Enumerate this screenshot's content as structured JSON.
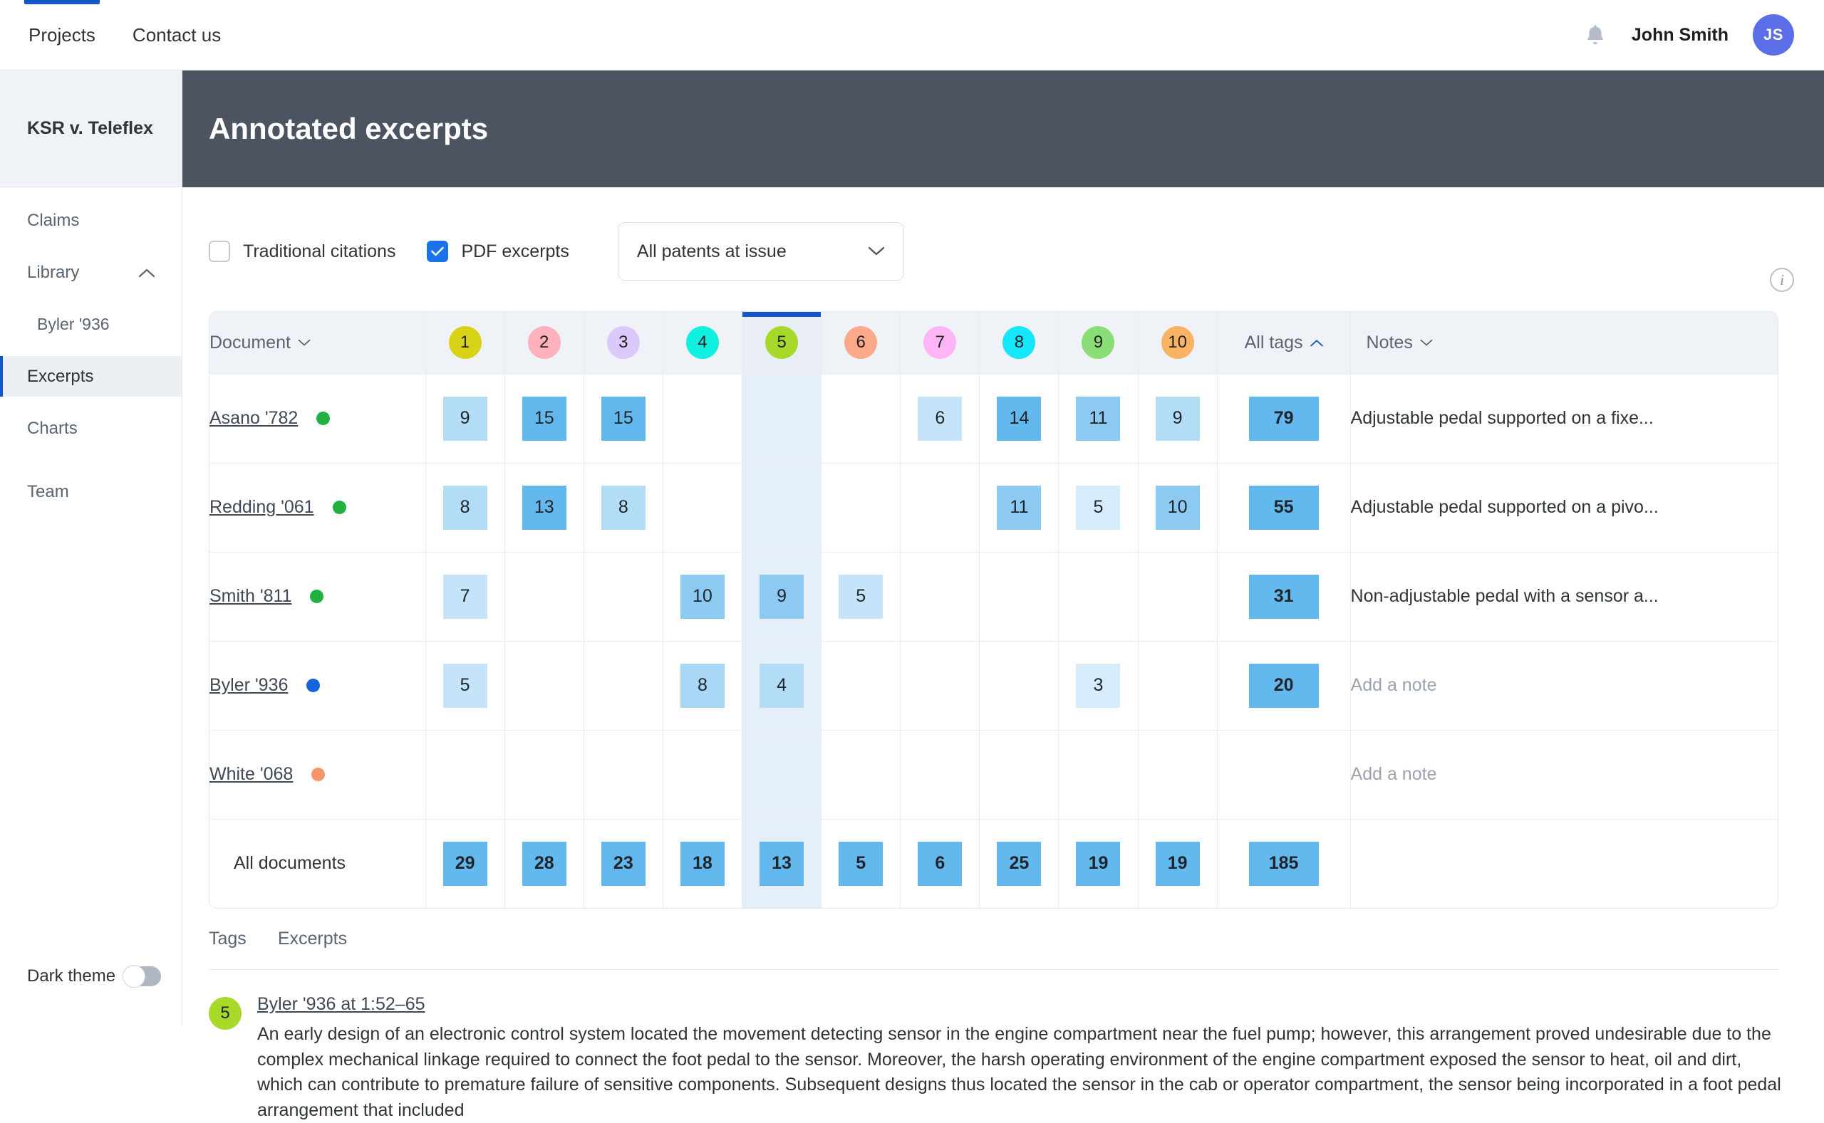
{
  "topnav": {
    "links": [
      {
        "label": "Projects",
        "active": true
      },
      {
        "label": "Contact us",
        "active": false
      }
    ],
    "bell_icon": "bell-icon",
    "user_name": "John Smith",
    "avatar_initials": "JS"
  },
  "sidebar": {
    "project_title": "KSR v. Teleflex",
    "items": [
      {
        "label": "Claims"
      },
      {
        "label": "Library"
      },
      {
        "label": "Byler '936"
      },
      {
        "label": "Excerpts"
      },
      {
        "label": "Charts"
      },
      {
        "label": "Team"
      }
    ],
    "theme_label": "Dark theme",
    "theme_enabled": false
  },
  "header": {
    "title": "Annotated excerpts"
  },
  "filters": {
    "traditional_citations": {
      "label": "Traditional citations",
      "checked": false
    },
    "pdf_excerpts": {
      "label": "PDF excerpts",
      "checked": true
    },
    "patent_select": {
      "value": "All patents at issue"
    },
    "info_icon": "info-icon"
  },
  "table": {
    "document_header": "Document",
    "all_tags_header": "All tags",
    "notes_header": "Notes",
    "tags": [
      {
        "number": "1",
        "color": "#d8d319"
      },
      {
        "number": "2",
        "color": "#feb0bd"
      },
      {
        "number": "3",
        "color": "#dbc9fb"
      },
      {
        "number": "4",
        "color": "#0ff0e0"
      },
      {
        "number": "5",
        "color": "#a6d92a",
        "selected": true
      },
      {
        "number": "6",
        "color": "#fba988"
      },
      {
        "number": "7",
        "color": "#fdb5f5"
      },
      {
        "number": "8",
        "color": "#14e7fa"
      },
      {
        "number": "9",
        "color": "#8ade75"
      },
      {
        "number": "10",
        "color": "#f9b365"
      }
    ],
    "rows": [
      {
        "document": "Asano '782",
        "status_color": "#21b141",
        "values": [
          "9",
          "15",
          "15",
          "",
          "",
          "",
          "6",
          "14",
          "11",
          "9"
        ],
        "shades": [
          "#b3ddf7",
          "#63b8ed",
          "#63b8ed",
          "",
          "",
          "",
          "#c5e4f9",
          "#63b8ed",
          "#8ccaf2",
          "#b3ddf7"
        ],
        "all_tags": "79",
        "all_tags_shade": "#63b8ed",
        "note": "Adjustable pedal supported on a fixe...",
        "note_empty": false
      },
      {
        "document": "Redding '061",
        "status_color": "#21b141",
        "values": [
          "8",
          "13",
          "8",
          "",
          "",
          "",
          "",
          "11",
          "5",
          "10"
        ],
        "shades": [
          "#b3ddf7",
          "#63b8ed",
          "#b3ddf7",
          "",
          "",
          "",
          "",
          "#8ccaf2",
          "#d6ecfb",
          "#8ccaf2"
        ],
        "all_tags": "55",
        "all_tags_shade": "#63b8ed",
        "note": "Adjustable pedal supported on a pivo...",
        "note_empty": false
      },
      {
        "document": "Smith '811",
        "status_color": "#21b141",
        "values": [
          "7",
          "",
          "",
          "10",
          "9",
          "5",
          "",
          "",
          "",
          ""
        ],
        "shades": [
          "#c5e4f9",
          "",
          "",
          "#8ccaf2",
          "#8ccaf2",
          "#c5e4f9",
          "",
          "",
          "",
          ""
        ],
        "all_tags": "31",
        "all_tags_shade": "#63b8ed",
        "note": "Non-adjustable pedal with a sensor a...",
        "note_empty": false
      },
      {
        "document": "Byler '936",
        "status_color": "#1565d8",
        "values": [
          "5",
          "",
          "",
          "8",
          "4",
          "",
          "",
          "",
          "3",
          ""
        ],
        "shades": [
          "#c5e4f9",
          "",
          "",
          "#a8d6f5",
          "#b3ddf7",
          "",
          "",
          "",
          "#d6ecfb",
          ""
        ],
        "all_tags": "20",
        "all_tags_shade": "#63b8ed",
        "note": "Add a note",
        "note_empty": true
      },
      {
        "document": "White '068",
        "status_color": "#f79468",
        "values": [
          "",
          "",
          "",
          "",
          "",
          "",
          "",
          "",
          "",
          ""
        ],
        "shades": [
          "",
          "",
          "",
          "",
          "",
          "",
          "",
          "",
          "",
          ""
        ],
        "all_tags": "",
        "all_tags_shade": "",
        "note": "Add a note",
        "note_empty": true
      }
    ],
    "totals": {
      "label": "All documents",
      "values": [
        "29",
        "28",
        "23",
        "18",
        "13",
        "5",
        "6",
        "25",
        "19",
        "19"
      ],
      "all_tags": "185",
      "shade": "#63b8ed"
    }
  },
  "bottom": {
    "tabs": [
      {
        "label": "Tags"
      },
      {
        "label": "Excerpts"
      }
    ],
    "excerpt": {
      "badge_number": "5",
      "badge_color": "#a6d92a",
      "citation": "Byler '936 at 1:52–65",
      "text": "An early design of an electronic control system located the movement detecting sensor in the engine compartment near the fuel pump; however, this arrangement proved undesirable due to the complex mechanical linkage required to connect the foot pedal to the sensor. Moreover, the harsh operating environment of the engine compartment exposed the sensor to heat, oil and dirt, which can contribute to premature failure of sensitive components. Subsequent designs thus located the sensor in the cab or operator compartment, the sensor being incorporated in a foot pedal arrangement that included"
    }
  }
}
